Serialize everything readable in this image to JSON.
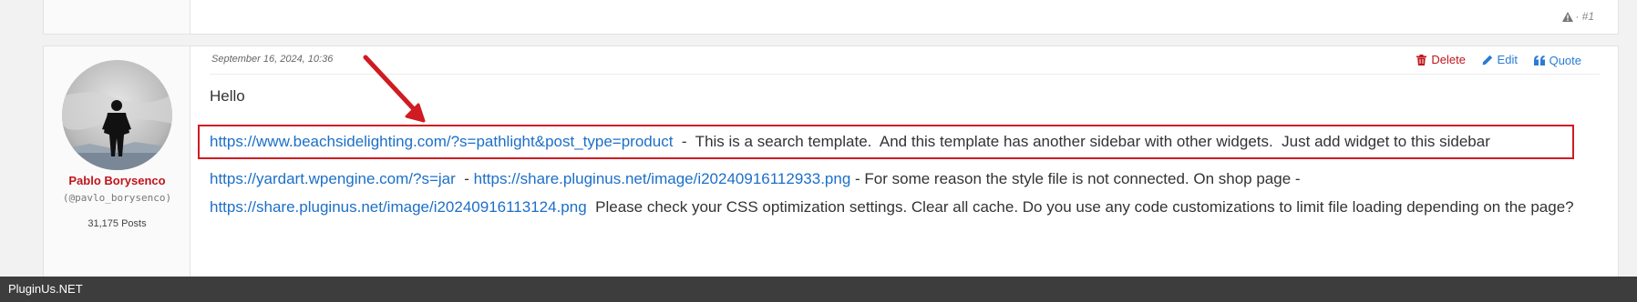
{
  "previous_post": {
    "post_number": "· #1"
  },
  "post": {
    "date": "September 16, 2024, 10:36",
    "author": {
      "name": "Pablo Borysenco",
      "handle": "(@pavlo_borysenco)",
      "posts": "31,175 Posts"
    },
    "actions": {
      "delete": "Delete",
      "edit": "Edit",
      "quote": "Quote"
    },
    "body": {
      "greeting": "Hello",
      "link1": "https://www.beachsidelighting.com/?s=pathlight&post_type=product",
      "text1": "  -  This is a search template.  And this template has another sidebar with other widgets.  Just add widget to this sidebar",
      "link2": "https://yardart.wpengine.com/?s=jar",
      "sep1": "  - ",
      "link3": "https://share.pluginus.net/image/i20240916112933.png",
      "text2": " - For some reason the style file is not connected. On shop page - ",
      "link4": "https://share.pluginus.net/image/i20240916113124.png",
      "text3": "  Please check your CSS optimization settings. Clear all cache. Do you use any code customizations to limit file loading depending on the page?"
    }
  },
  "footer": {
    "site_name": "PluginUs.NET"
  },
  "colors": {
    "author_name": "#c0151b",
    "link": "#1c6fc9",
    "annotation": "#d01b22",
    "footer_bg": "#3d3d3d"
  },
  "icons": [
    "warning-icon",
    "trash-icon",
    "pencil-icon",
    "quote-icon",
    "annotation-arrow"
  ]
}
